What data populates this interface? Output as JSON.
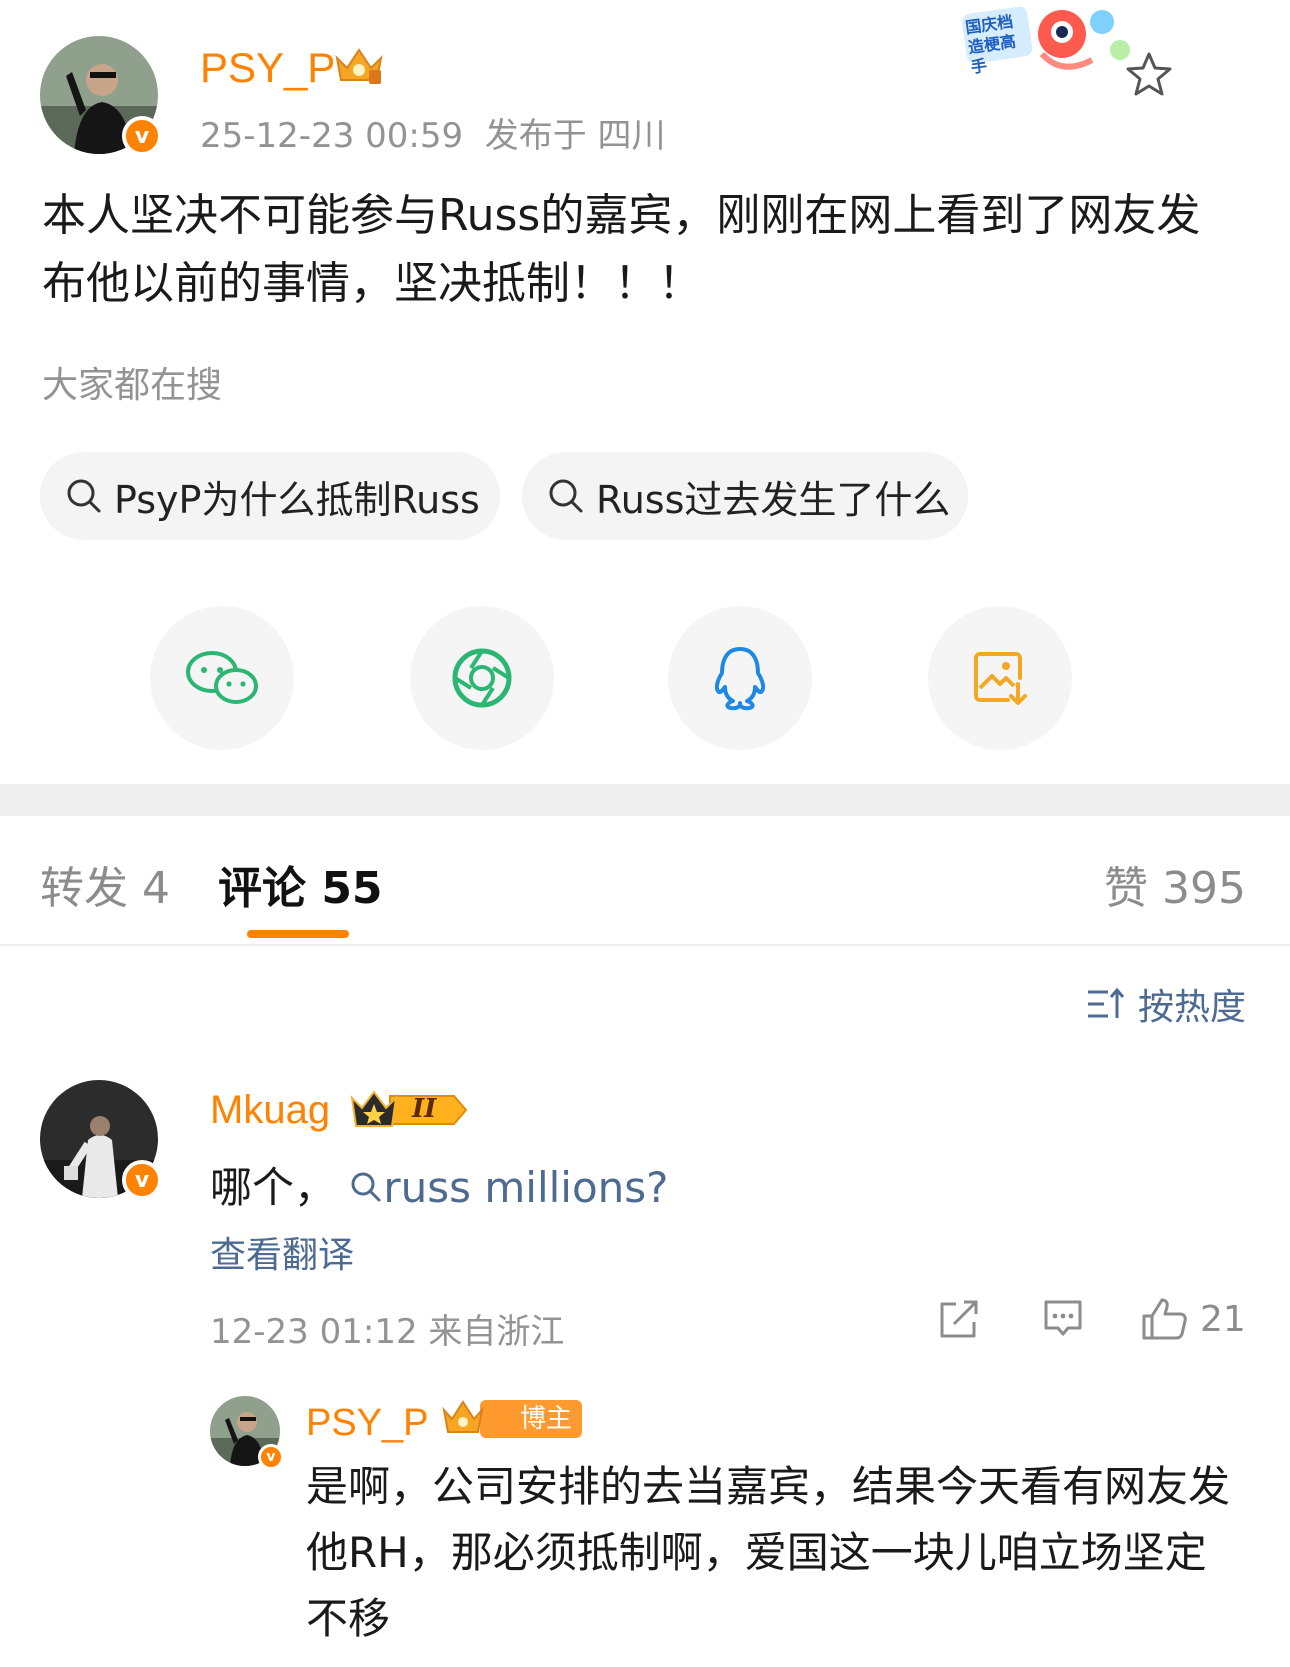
{
  "post": {
    "author": "PSY_P",
    "time": "25-12-23 00:59",
    "location": "发布于 四川",
    "text": "本人坚决不可能参与Russ的嘉宾，刚刚在网上看到了网友发布他以前的事情，坚决抵制！！！",
    "badge_text": "国庆档 造梗高手"
  },
  "search": {
    "label": "大家都在搜",
    "chips": [
      "PsyP为什么抵制Russ",
      "Russ过去发生了什么"
    ]
  },
  "share": {
    "items": [
      "wechat-icon",
      "moments-icon",
      "qq-icon",
      "save-image-icon"
    ]
  },
  "tabs": {
    "repost": "转发 4",
    "comments": "评论 55",
    "likes": "赞 395"
  },
  "sort": {
    "label": "按热度"
  },
  "comment": {
    "author": "Mkuag",
    "level": "II",
    "text_prefix": "哪个，",
    "link": "russ millions?",
    "translate": "查看翻译",
    "meta": "12-23 01:12 来自浙江",
    "likes": "21"
  },
  "reply": {
    "author": "PSY_P",
    "tag": "博主",
    "text": "是啊，公司安排的去当嘉宾，结果今天看有网友发他RH，那必须抵制啊，爱国这一块儿咱立场坚定不移"
  },
  "colors": {
    "accent": "#ff8200",
    "link": "#4d6a93",
    "muted": "#939393"
  }
}
